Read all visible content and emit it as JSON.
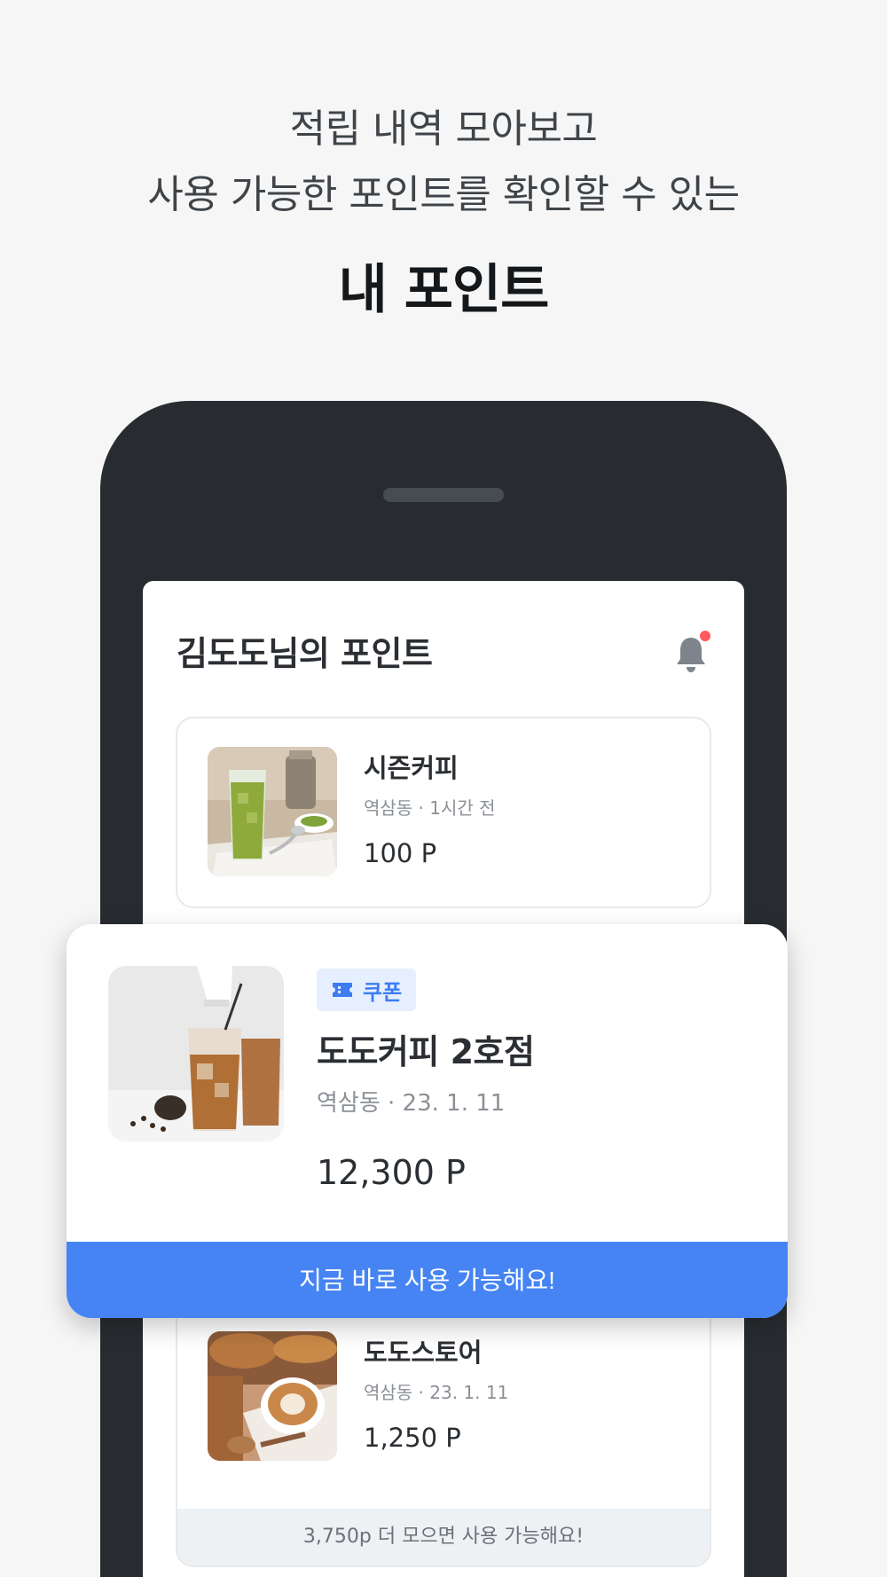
{
  "headline": {
    "line1": "적립 내역 모아보고",
    "line2": "사용 가능한 포인트를 확인할 수 있는",
    "title": "내 포인트"
  },
  "screen": {
    "title": "김도도님의 포인트",
    "notification_icon": "bell-icon"
  },
  "cards": [
    {
      "name": "시즌커피",
      "meta": "역삼동 · 1시간 전",
      "points": "100 P"
    },
    {
      "badge": "쿠폰",
      "badge_icon": "ticket-icon",
      "name": "도도커피 2호점",
      "meta": "역삼동 · 23. 1. 11",
      "points": "12,300 P",
      "cta": "지금 바로 사용 가능해요!"
    },
    {
      "name": "도도스토어",
      "meta": "역삼동 · 23. 1. 11",
      "points": "1,250 P",
      "footer": "3,750p 더 모으면 사용 가능해요!"
    }
  ],
  "colors": {
    "accent": "#4684f3",
    "badge_bg": "#e6efff",
    "phone": "#282c30",
    "notification_dot": "#ff5a5f"
  }
}
